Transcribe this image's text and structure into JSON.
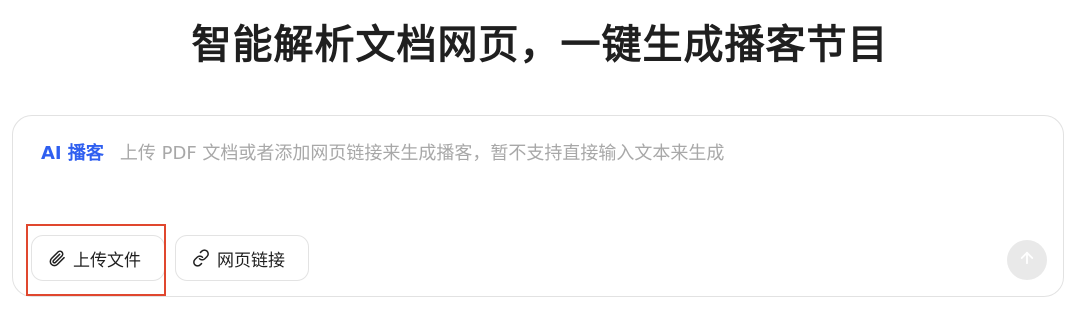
{
  "headline": "智能解析文档网页，一键生成播客节目",
  "composer": {
    "tag": "AI 播客",
    "placeholder": "上传 PDF 文档或者添加网页链接来生成播客，暂不支持直接输入文本来生成"
  },
  "actions": {
    "upload_label": "上传文件",
    "link_label": "网页链接"
  },
  "icons": {
    "upload": "paperclip-icon",
    "link": "link-icon",
    "send": "arrow-up-icon"
  },
  "colors": {
    "accent": "#2f5ff0",
    "highlight": "#e0472e",
    "send_disabled": "#e9e9e9"
  }
}
